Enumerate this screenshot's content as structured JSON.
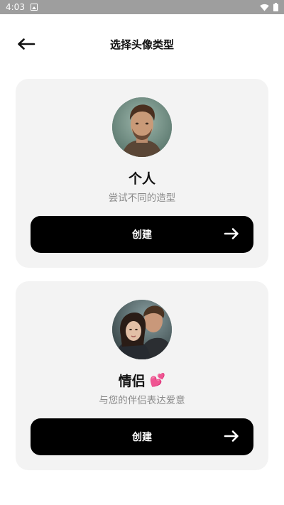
{
  "status_bar": {
    "time": "4:03",
    "icons": [
      "image-notification-icon",
      "wifi-icon",
      "battery-icon"
    ]
  },
  "header": {
    "title": "选择头像类型",
    "back_icon": "arrow-left-icon"
  },
  "cards": [
    {
      "title": "个人",
      "subtitle": "尝试不同的造型",
      "button_label": "创建",
      "emoji": ""
    },
    {
      "title": "情侣",
      "subtitle": "与您的伴侣表达爱意",
      "button_label": "创建",
      "emoji": "💕"
    }
  ],
  "colors": {
    "card_bg": "#f3f3f3",
    "button_bg": "#000000",
    "subtitle": "#8a8a8a",
    "status_bar": "#9e9e9e"
  }
}
